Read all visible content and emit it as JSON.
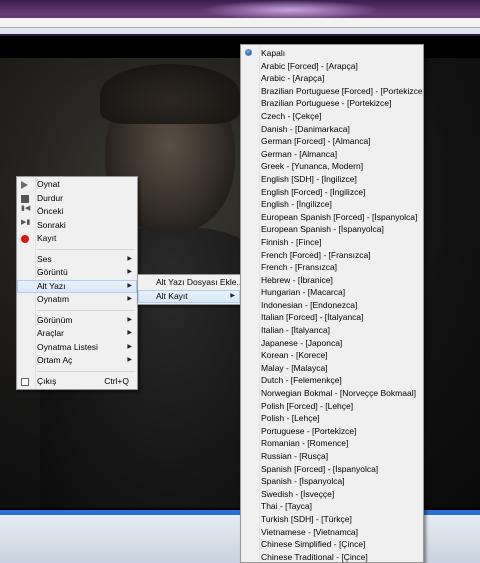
{
  "context_menu": {
    "items": [
      {
        "label": "Oynat",
        "icon": "play-icon"
      },
      {
        "label": "Durdur",
        "icon": "stop-icon"
      },
      {
        "label": "Önceki",
        "icon": "previous-icon"
      },
      {
        "label": "Sonraki",
        "icon": "next-icon"
      },
      {
        "label": "Kayıt",
        "icon": "record-icon"
      }
    ],
    "submenus": [
      {
        "label": "Ses"
      },
      {
        "label": "Görüntü"
      },
      {
        "label": "Alt Yazı"
      },
      {
        "label": "Oynatım"
      }
    ],
    "submenus2": [
      {
        "label": "Görünüm"
      },
      {
        "label": "Araçlar"
      },
      {
        "label": "Oynatma Listesi"
      },
      {
        "label": "Ortam Aç"
      }
    ],
    "exit": {
      "label": "Çıkış",
      "shortcut": "Ctrl+Q",
      "icon": "exit-icon"
    }
  },
  "subtitle_menu": {
    "items": [
      {
        "label": "Alt Yazı Dosyası Ekle..."
      },
      {
        "label": "Alt Kayıt"
      }
    ]
  },
  "subtitle_tracks": {
    "selected": "Kapalı",
    "items": [
      "Kapalı",
      "Arabic [Forced] - [Arapça]",
      "Arabic - [Arapça]",
      "Brazilian Portuguese [Forced] - [Portekizce]",
      "Brazilian Portuguese - [Portekizce]",
      "Czech - [Çekçe]",
      "Danish - [Danimarkaca]",
      "German [Forced] - [Almanca]",
      "German - [Almanca]",
      "Greek - [Yunanca, Modern]",
      "English [SDH] - [İngilizce]",
      "English [Forced] - [İngilizce]",
      "English - [İngilizce]",
      "European Spanish [Forced] - [İspanyolca]",
      "European Spanish - [İspanyolca]",
      "Finnish - [Fince]",
      "French [Forced] - [Fransızca]",
      "French - [Fransızca]",
      "Hebrew - [İbranice]",
      "Hungarian - [Macarca]",
      "Indonesian - [Endonezca]",
      "Italian [Forced] - [İtalyanca]",
      "Italian - [İtalyanca]",
      "Japanese - [Japonca]",
      "Korean - [Korece]",
      "Malay - [Malayca]",
      "Dutch - [Felemenkçe]",
      "Norwegian Bokmal - [Norveççe Bokmaal]",
      "Polish [Forced] - [Lehçe]",
      "Polish - [Lehçe]",
      "Portuguese - [Portekizce]",
      "Romanian - [Romence]",
      "Russian - [Rusça]",
      "Spanish [Forced] - [İspanyolca]",
      "Spanish - [İspanyolca]",
      "Swedish - [İsveççe]",
      "Thai - [Tayca]",
      "Turkish [SDH] - [Türkçe]",
      "Vietnamese - [Vietnamca]",
      "Chinese Simplified - [Çince]",
      "Chinese Traditional - [Çince]"
    ]
  },
  "colors": {
    "menu_bg": "#f0f0f0",
    "highlight": "#d7e7f8",
    "record": "#e01010",
    "seek_bar": "#2b6fd0"
  }
}
